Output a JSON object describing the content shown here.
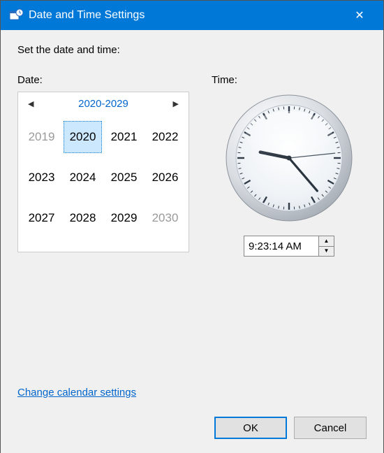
{
  "window": {
    "title": "Date and Time Settings",
    "close_glyph": "✕"
  },
  "prompt": "Set the date and time:",
  "labels": {
    "date": "Date:",
    "time": "Time:"
  },
  "calendar": {
    "title": "2020-2029",
    "prev_glyph": "◀",
    "next_glyph": "▶",
    "cells": [
      {
        "label": "2019",
        "out": true,
        "selected": false
      },
      {
        "label": "2020",
        "out": false,
        "selected": true
      },
      {
        "label": "2021",
        "out": false,
        "selected": false
      },
      {
        "label": "2022",
        "out": false,
        "selected": false
      },
      {
        "label": "2023",
        "out": false,
        "selected": false
      },
      {
        "label": "2024",
        "out": false,
        "selected": false
      },
      {
        "label": "2025",
        "out": false,
        "selected": false
      },
      {
        "label": "2026",
        "out": false,
        "selected": false
      },
      {
        "label": "2027",
        "out": false,
        "selected": false
      },
      {
        "label": "2028",
        "out": false,
        "selected": false
      },
      {
        "label": "2029",
        "out": false,
        "selected": false
      },
      {
        "label": "2030",
        "out": true,
        "selected": false
      }
    ]
  },
  "time": {
    "value": "9:23:14 AM",
    "hour": 9,
    "minute": 23,
    "second": 14,
    "up_glyph": "▲",
    "down_glyph": "▼"
  },
  "link": "Change calendar settings",
  "buttons": {
    "ok": "OK",
    "cancel": "Cancel"
  },
  "colors": {
    "accent": "#0078d7",
    "link": "#0066cc"
  }
}
